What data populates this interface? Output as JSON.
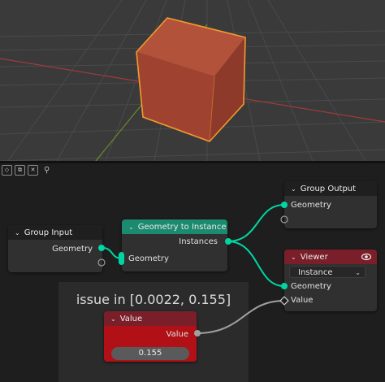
{
  "viewport": {
    "cube_color": "#a8462f",
    "outline_color": "#f29a2e",
    "floor_color": "#3a3a3a"
  },
  "editor": {
    "header_icons": [
      "shield-icon",
      "copy-icon",
      "close-icon",
      "pin-icon"
    ],
    "frame": {
      "label": "issue in [0.0022, 0.155]"
    },
    "nodes": {
      "group_input": {
        "title": "Group Input",
        "outputs": [
          "Geometry"
        ]
      },
      "geometry_to_instance": {
        "title": "Geometry to Instance",
        "outputs": [
          "Instances"
        ],
        "inputs": [
          "Geometry"
        ]
      },
      "group_output": {
        "title": "Group Output",
        "inputs": [
          "Geometry"
        ]
      },
      "viewer": {
        "title": "Viewer",
        "dropdown": "Instance",
        "inputs": [
          "Geometry",
          "Value"
        ]
      },
      "value": {
        "title": "Value",
        "outputs": [
          "Value"
        ],
        "field": "0.155"
      }
    },
    "colors": {
      "geometry_socket": "#00d6a3",
      "float_socket": "#a1a1a1",
      "green_header": "#1b8a6f",
      "red_header": "#7a1f2a"
    }
  }
}
